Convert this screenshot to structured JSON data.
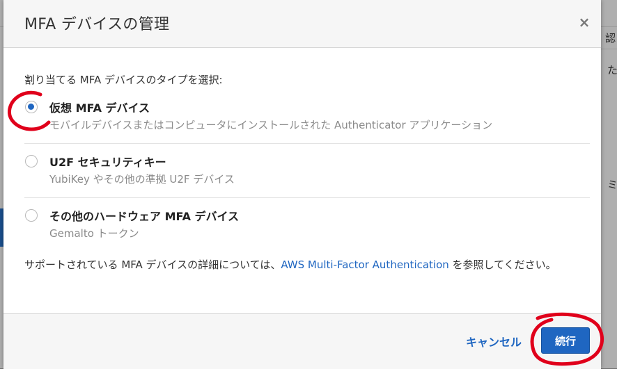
{
  "dialog": {
    "title": "MFA デバイスの管理",
    "close_symbol": "×",
    "prompt": "割り当てる MFA デバイスのタイプを選択:",
    "options": [
      {
        "title": "仮想 MFA デバイス",
        "description": "モバイルデバイスまたはコンピュータにインストールされた Authenticator アプリケーション",
        "selected": true
      },
      {
        "title": "U2F セキュリティキー",
        "description": "YubiKey やその他の準拠 U2F デバイス",
        "selected": false
      },
      {
        "title": "その他のハードウェア MFA デバイス",
        "description": "Gemalto トークン",
        "selected": false
      }
    ],
    "info_prefix": "サポートされている MFA デバイスの詳細については、",
    "info_link": "AWS Multi-Factor Authentication",
    "info_suffix": " を参照してください。",
    "cancel_label": "キャンセル",
    "continue_label": "続行"
  },
  "background_fragments": {
    "top_right": "認",
    "mid_right_1": "た",
    "mid_right_2": "ミ"
  },
  "colors": {
    "accent": "#1f66c1",
    "annotation": "#e0001b"
  }
}
